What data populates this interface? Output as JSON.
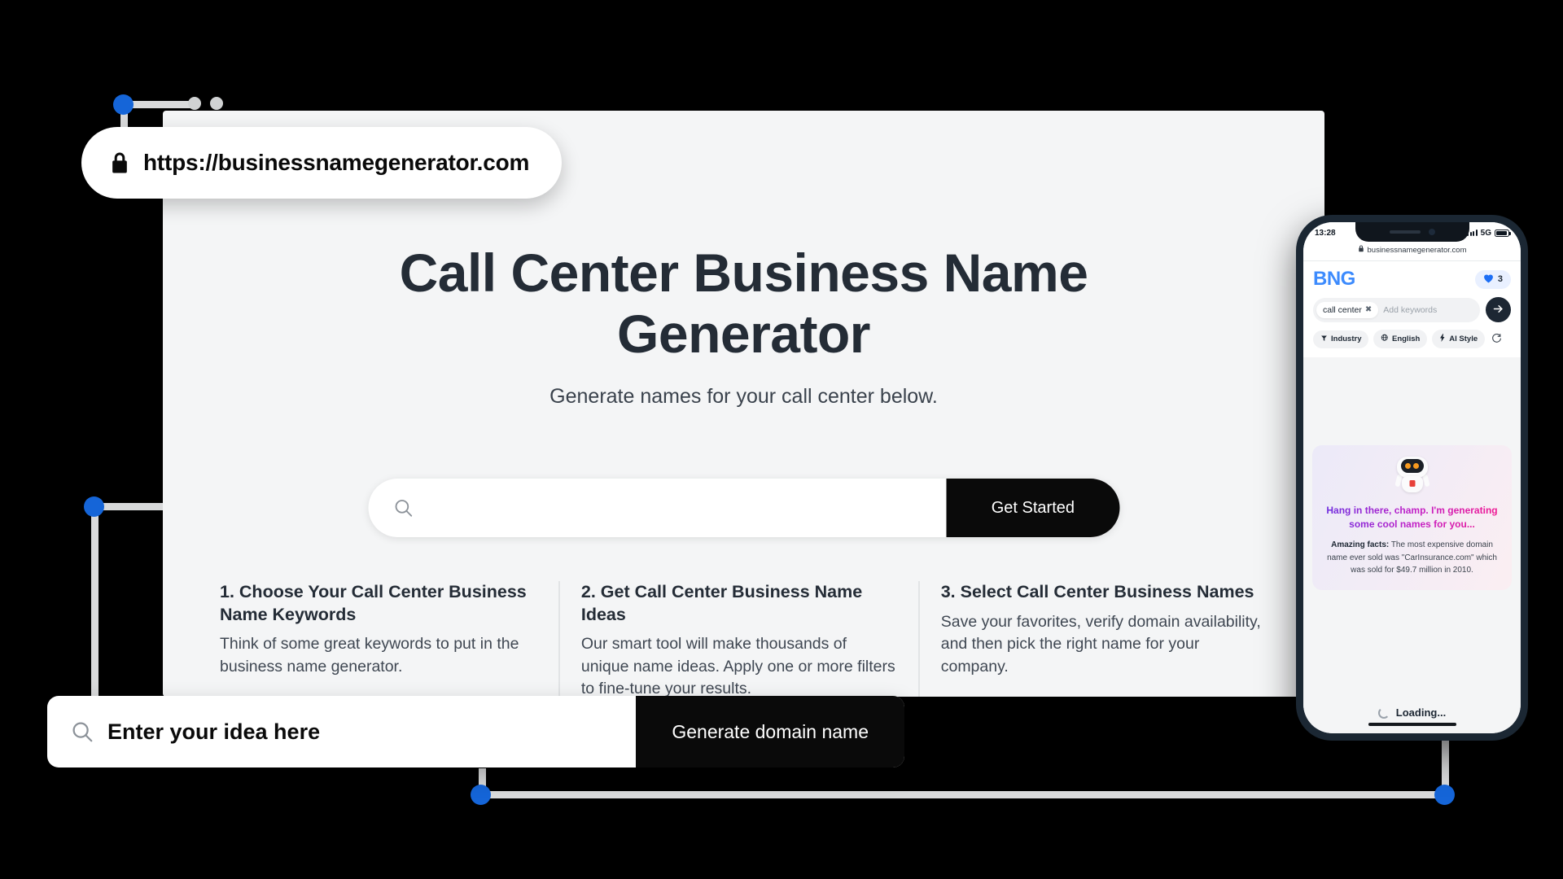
{
  "browser": {
    "url": "https://businessnamegenerator.com",
    "lock_icon": "lock-icon",
    "chrome_dots": 2
  },
  "hero": {
    "title": "Call Center Business Name Generator",
    "subtitle": "Generate names for your call center below."
  },
  "search": {
    "icon": "search-icon",
    "placeholder": "",
    "value": "",
    "button_label": "Get Started"
  },
  "features": [
    {
      "heading": "1. Choose Your Call Center Business Name Keywords",
      "body": "Think of some great keywords to put in the business name generator."
    },
    {
      "heading": "2. Get Call Center Business Name Ideas",
      "body": "Our smart tool will make thousands of unique name ideas. Apply one or more filters to fine-tune your results."
    },
    {
      "heading": "3. Select Call Center Business Names",
      "body": "Save your favorites, verify domain availability, and then pick the right name for your company."
    }
  ],
  "idea_bar": {
    "icon": "search-icon",
    "placeholder": "Enter your idea here",
    "value": "",
    "button_label": "Generate domain name"
  },
  "phone": {
    "status": {
      "time": "13:28",
      "network": "5G",
      "signal_icon": "signal-bars-icon",
      "battery_icon": "battery-icon"
    },
    "mini_url": "businessnamegenerator.com",
    "mini_url_lock_icon": "lock-icon",
    "app": {
      "logo": "BNG",
      "favorites": {
        "icon": "heart-icon",
        "count": "3"
      },
      "keyword_chip": {
        "label": "call center",
        "remove_icon": "close-icon"
      },
      "keyword_placeholder": "Add keywords",
      "submit_icon": "arrow-right-icon",
      "filters": [
        {
          "label": "Industry",
          "icon": "filter-icon"
        },
        {
          "label": "English",
          "icon": "globe-icon"
        },
        {
          "label": "AI Style",
          "icon": "bolt-icon"
        }
      ],
      "refresh_icon": "refresh-icon",
      "robot_icon": "robot-icon",
      "robot_message": "Hang in there, champ. I'm generating some cool names for you...",
      "fact_label": "Amazing facts:",
      "fact_text": " The most expensive domain name ever sold was \"CarInsurance.com\" which was sold for $49.7 million in 2010.",
      "loading_label": "Loading...",
      "loading_icon": "spinner-icon"
    }
  },
  "colors": {
    "background": "#000000",
    "card": "#f4f5f6",
    "ink": "#242c36",
    "accent_blue": "#1565d8",
    "logo_blue": "#3d8bfd",
    "button_black": "#0a0a0a",
    "wire_gray": "#d9dadb"
  }
}
